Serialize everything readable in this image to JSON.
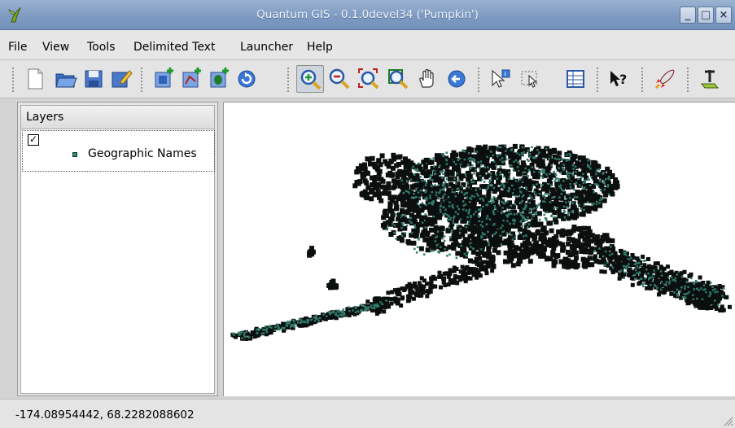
{
  "window": {
    "title": "Quantum GIS - 0.1.0devel34 ('Pumpkin')",
    "controls": [
      "_",
      "□",
      "×"
    ]
  },
  "menubar": {
    "items": [
      "File",
      "View",
      "Tools",
      "Delimited Text",
      "Launcher",
      "Help"
    ]
  },
  "toolbar": {
    "groups": [
      [
        "new-project-icon",
        "open-project-icon",
        "save-project-icon",
        "save-as-icon"
      ],
      [
        "add-raster-icon",
        "add-vector-icon",
        "add-postgis-icon",
        "refresh-icon"
      ],
      [
        "zoom-in-icon",
        "zoom-out-icon",
        "zoom-full-icon",
        "zoom-layer-icon",
        "pan-icon",
        "zoom-last-icon"
      ],
      [
        "identify-icon",
        "select-icon",
        "attribute-table-icon"
      ],
      [
        "whats-this-icon"
      ],
      [
        "launcher-icon"
      ],
      [
        "plugin-icon"
      ]
    ],
    "active_tool": "zoom-in-icon"
  },
  "layers_panel": {
    "header": "Layers",
    "layers": [
      {
        "name": "Geographic Names",
        "checked": true,
        "symbol_color": "#3b8a78"
      }
    ]
  },
  "map": {
    "point_fill": "#2f7a6a",
    "point_stroke": "#000000"
  },
  "statusbar": {
    "coordinates": "-174.08954442, 68.2282088602"
  }
}
